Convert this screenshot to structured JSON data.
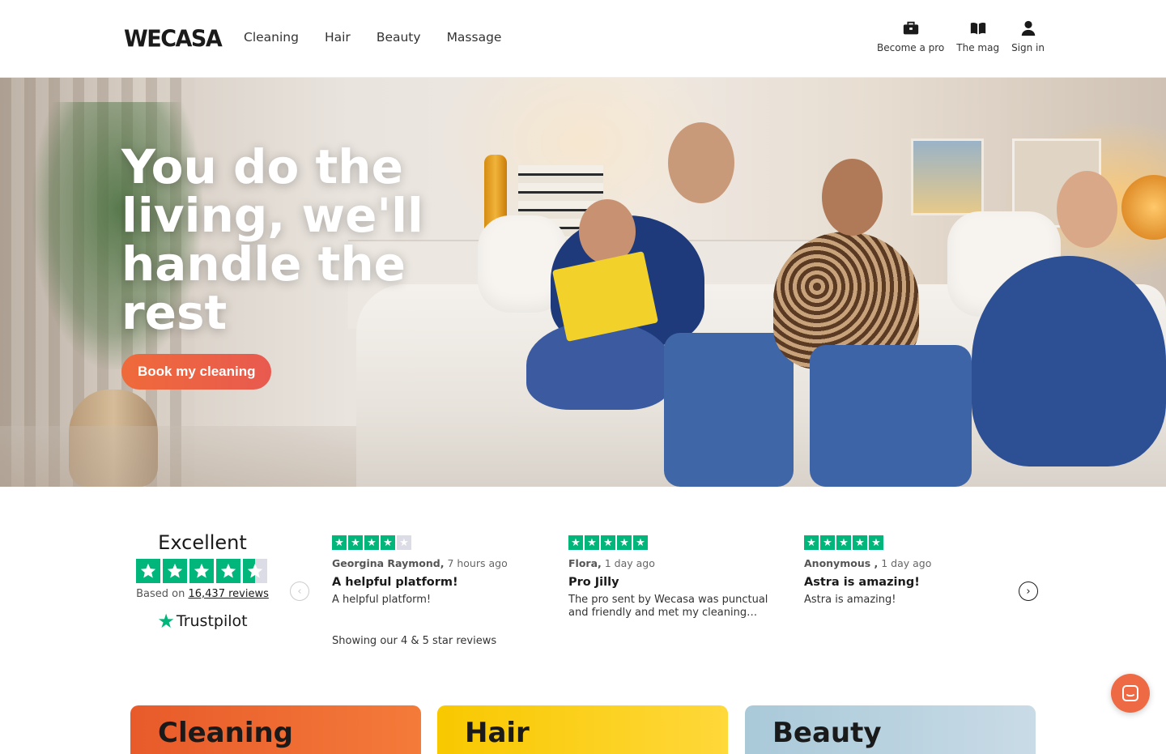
{
  "header": {
    "logo": "WECASA",
    "nav": [
      "Cleaning",
      "Hair",
      "Beauty",
      "Massage"
    ],
    "actions": {
      "become_pro": "Become a pro",
      "mag": "The mag",
      "sign_in": "Sign in"
    }
  },
  "hero": {
    "title": "You do the living, we'll handle the rest",
    "cta": "Book my cleaning"
  },
  "trustpilot": {
    "rating_label": "Excellent",
    "based_on_prefix": "Based on",
    "review_count": "16,437 reviews",
    "brand": "Trustpilot",
    "star_rating": 4.5,
    "showing": "Showing our 4 & 5 star reviews"
  },
  "reviews": [
    {
      "author": "Georgina Raymond,",
      "time": "7 hours ago",
      "title": "A helpful platform!",
      "body": "A helpful platform!",
      "stars": 4
    },
    {
      "author": "Flora,",
      "time": "1 day ago",
      "title": "Pro Jilly",
      "body": "The pro sent by Wecasa was punctual and friendly and met my cleaning…",
      "stars": 5
    },
    {
      "author": "Anonymous ,",
      "time": "1 day ago",
      "title": "Astra is amazing!",
      "body": "Astra is amazing!",
      "stars": 5
    }
  ],
  "categories": [
    "Cleaning",
    "Hair",
    "Beauty"
  ],
  "colors": {
    "accent": "#ee6a44",
    "trustpilot_green": "#00b67a"
  },
  "icons": [
    "briefcase-icon",
    "book-icon",
    "user-icon",
    "chevron-left-icon",
    "chevron-right-icon",
    "chat-icon"
  ]
}
